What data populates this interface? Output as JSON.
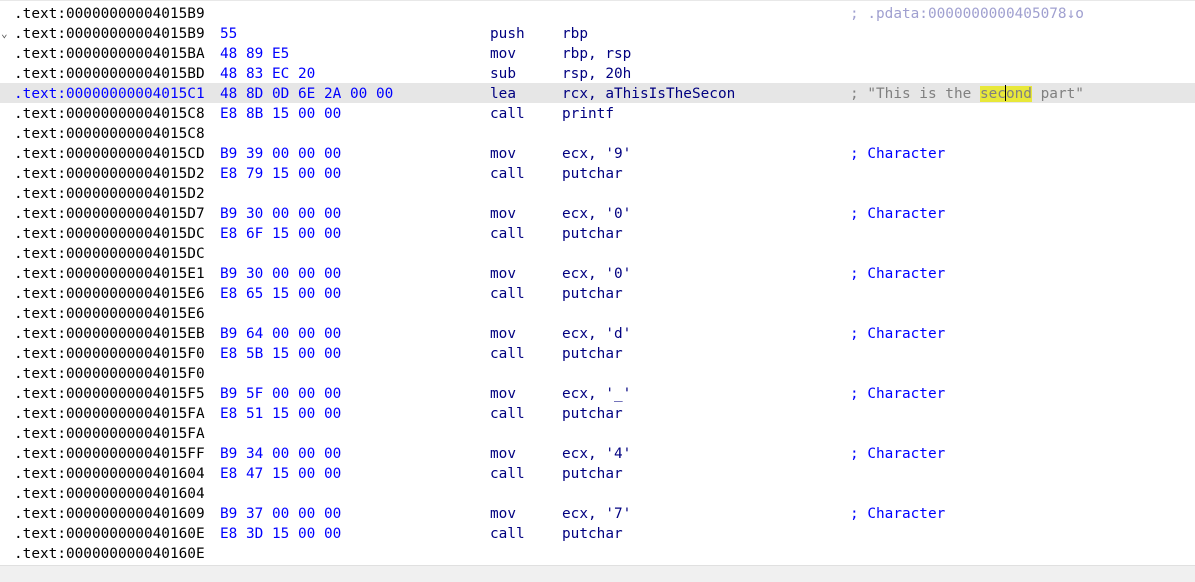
{
  "lines": [
    {
      "addr": ".text:00000000004015B9",
      "bytes": "",
      "mnem": "",
      "ops": "",
      "comment": "; .pdata:0000000000405078↓o",
      "comment_style": "faded"
    },
    {
      "addr": ".text:00000000004015B9",
      "bytes": "55",
      "mnem": "push",
      "ops": "rbp",
      "comment": "",
      "fold": "⌄"
    },
    {
      "addr": ".text:00000000004015BA",
      "bytes": "48 89 E5",
      "mnem": "mov",
      "ops": "rbp, rsp",
      "comment": ""
    },
    {
      "addr": ".text:00000000004015BD",
      "bytes": "48 83 EC 20",
      "mnem": "sub",
      "ops": "rsp, 20h",
      "comment": ""
    },
    {
      "addr": ".text:00000000004015C1",
      "bytes": "48 8D 0D 6E 2A 00 00",
      "mnem": "lea",
      "ops": "rcx, aThisIsTheSecon",
      "comment": "; \"This is the second part\"",
      "comment_style": "gray",
      "selected": true
    },
    {
      "addr": ".text:00000000004015C8",
      "bytes": "E8 8B 15 00 00",
      "mnem": "call",
      "ops": "printf",
      "comment": ""
    },
    {
      "addr": ".text:00000000004015C8",
      "bytes": "",
      "mnem": "",
      "ops": "",
      "comment": ""
    },
    {
      "addr": ".text:00000000004015CD",
      "bytes": "B9 39 00 00 00",
      "mnem": "mov",
      "ops": "ecx, '9'",
      "comment": "; Character"
    },
    {
      "addr": ".text:00000000004015D2",
      "bytes": "E8 79 15 00 00",
      "mnem": "call",
      "ops": "putchar",
      "comment": ""
    },
    {
      "addr": ".text:00000000004015D2",
      "bytes": "",
      "mnem": "",
      "ops": "",
      "comment": ""
    },
    {
      "addr": ".text:00000000004015D7",
      "bytes": "B9 30 00 00 00",
      "mnem": "mov",
      "ops": "ecx, '0'",
      "comment": "; Character"
    },
    {
      "addr": ".text:00000000004015DC",
      "bytes": "E8 6F 15 00 00",
      "mnem": "call",
      "ops": "putchar",
      "comment": ""
    },
    {
      "addr": ".text:00000000004015DC",
      "bytes": "",
      "mnem": "",
      "ops": "",
      "comment": ""
    },
    {
      "addr": ".text:00000000004015E1",
      "bytes": "B9 30 00 00 00",
      "mnem": "mov",
      "ops": "ecx, '0'",
      "comment": "; Character"
    },
    {
      "addr": ".text:00000000004015E6",
      "bytes": "E8 65 15 00 00",
      "mnem": "call",
      "ops": "putchar",
      "comment": ""
    },
    {
      "addr": ".text:00000000004015E6",
      "bytes": "",
      "mnem": "",
      "ops": "",
      "comment": ""
    },
    {
      "addr": ".text:00000000004015EB",
      "bytes": "B9 64 00 00 00",
      "mnem": "mov",
      "ops": "ecx, 'd'",
      "comment": "; Character"
    },
    {
      "addr": ".text:00000000004015F0",
      "bytes": "E8 5B 15 00 00",
      "mnem": "call",
      "ops": "putchar",
      "comment": ""
    },
    {
      "addr": ".text:00000000004015F0",
      "bytes": "",
      "mnem": "",
      "ops": "",
      "comment": ""
    },
    {
      "addr": ".text:00000000004015F5",
      "bytes": "B9 5F 00 00 00",
      "mnem": "mov",
      "ops": "ecx, '_'",
      "comment": "; Character"
    },
    {
      "addr": ".text:00000000004015FA",
      "bytes": "E8 51 15 00 00",
      "mnem": "call",
      "ops": "putchar",
      "comment": ""
    },
    {
      "addr": ".text:00000000004015FA",
      "bytes": "",
      "mnem": "",
      "ops": "",
      "comment": ""
    },
    {
      "addr": ".text:00000000004015FF",
      "bytes": "B9 34 00 00 00",
      "mnem": "mov",
      "ops": "ecx, '4'",
      "comment": "; Character"
    },
    {
      "addr": ".text:0000000000401604",
      "bytes": "E8 47 15 00 00",
      "mnem": "call",
      "ops": "putchar",
      "comment": ""
    },
    {
      "addr": ".text:0000000000401604",
      "bytes": "",
      "mnem": "",
      "ops": "",
      "comment": ""
    },
    {
      "addr": ".text:0000000000401609",
      "bytes": "B9 37 00 00 00",
      "mnem": "mov",
      "ops": "ecx, '7'",
      "comment": "; Character"
    },
    {
      "addr": ".text:000000000040160E",
      "bytes": "E8 3D 15 00 00",
      "mnem": "call",
      "ops": "putchar",
      "comment": ""
    },
    {
      "addr": ".text:000000000040160E",
      "bytes": "",
      "mnem": "",
      "ops": "",
      "comment": ""
    }
  ],
  "search_highlight": "second",
  "colors": {
    "background": "#ffffff",
    "selected_line": "#e6e6e6",
    "highlight": "#e8e83a",
    "address": "#000000",
    "bytes": "#0000ff",
    "instruction": "#000080",
    "comment": "#0000ff",
    "string_comment": "#808080"
  }
}
